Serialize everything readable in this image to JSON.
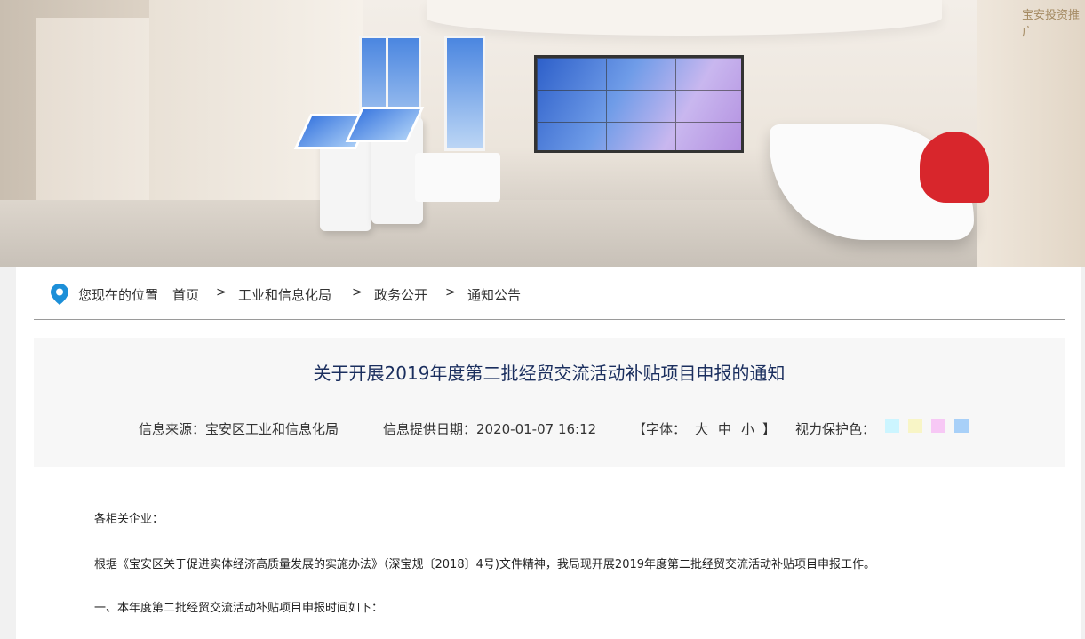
{
  "banner": {
    "sign_text": "宝安投资推广"
  },
  "breadcrumb": {
    "location_label": "您现在的位置",
    "items": [
      "首页",
      "工业和信息化局",
      "政务公开",
      "通知公告"
    ],
    "separator": ">"
  },
  "article": {
    "title": "关于开展2019年度第二批经贸交流活动补贴项目申报的通知",
    "source": "信息来源：宝安区工业和信息化局",
    "date": "信息提供日期：2020-01-07 16:12",
    "font_open": "【字体：",
    "font_sizes": [
      "大",
      "中",
      "小"
    ],
    "font_close": "】",
    "eye_label": "视力保护色：",
    "eye_colors": [
      "#ccf5ff",
      "#f8f5c6",
      "#f7c8f5",
      "#a8d0f8"
    ],
    "paragraphs": [
      "各相关企业：",
      "根据《宝安区关于促进实体经济高质量发展的实施办法》（深宝规〔2018〕4号)文件精神，我局现开展2019年度第二批经贸交流活动补贴项目申报工作。",
      "一、本年度第二批经贸交流活动补贴项目申报时间如下："
    ]
  }
}
